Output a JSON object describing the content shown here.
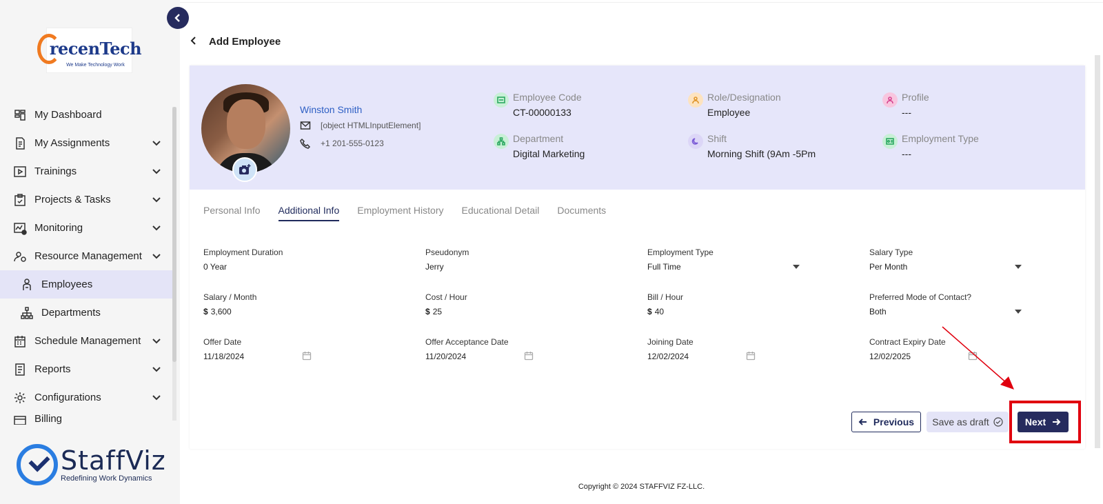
{
  "sidebar": {
    "brand_top": {
      "name_part1": "recen",
      "name_part2": "Tech",
      "tagline": "We Make Technology Work"
    },
    "items": [
      {
        "label": "My Dashboard",
        "icon": "dashboard-icon"
      },
      {
        "label": "My Assignments",
        "icon": "assignments-icon"
      },
      {
        "label": "Trainings",
        "icon": "play-icon"
      },
      {
        "label": "Projects & Tasks",
        "icon": "clipboard-icon"
      },
      {
        "label": "Monitoring",
        "icon": "monitoring-icon"
      },
      {
        "label": "Resource Management",
        "icon": "resource-icon"
      },
      {
        "label": "Employees",
        "icon": "employee-icon",
        "active": true
      },
      {
        "label": "Departments",
        "icon": "org-chart-icon"
      },
      {
        "label": "Schedule Management",
        "icon": "calendar-icon"
      },
      {
        "label": "Reports",
        "icon": "report-icon"
      },
      {
        "label": "Configurations",
        "icon": "settings-icon"
      },
      {
        "label": "Billing",
        "icon": "billing-icon"
      }
    ],
    "brand_bottom": {
      "name": "StaffViz",
      "tagline": "Redefining Work Dynamics"
    }
  },
  "page": {
    "title": "Add Employee"
  },
  "profile": {
    "name": "Winston Smith",
    "email": "[object HTMLInputElement]",
    "phone": "+1 201-555-0123",
    "meta": {
      "employee_code": {
        "label": "Employee Code",
        "value": "CT-00000133"
      },
      "role": {
        "label": "Role/Designation",
        "value": "Employee"
      },
      "profile": {
        "label": "Profile",
        "value": "---"
      },
      "department": {
        "label": "Department",
        "value": "Digital Marketing"
      },
      "shift": {
        "label": "Shift",
        "value": "Morning Shift (9Am -5Pm"
      },
      "employment_type": {
        "label": "Employment Type",
        "value": "---"
      }
    }
  },
  "tabs": [
    "Personal Info",
    "Additional Info",
    "Employment History",
    "Educational Detail",
    "Documents"
  ],
  "form": {
    "employment_duration": {
      "label": "Employment Duration",
      "value": "0 Year"
    },
    "pseudonym": {
      "label": "Pseudonym",
      "value": "Jerry"
    },
    "employment_type": {
      "label": "Employment Type",
      "value": "Full Time"
    },
    "salary_type": {
      "label": "Salary Type",
      "value": "Per Month"
    },
    "salary_month": {
      "label": "Salary / Month",
      "currency": "$",
      "value": "3,600"
    },
    "cost_hour": {
      "label": "Cost / Hour",
      "currency": "$",
      "value": "25"
    },
    "bill_hour": {
      "label": "Bill / Hour",
      "currency": "$",
      "value": "40"
    },
    "contact_mode": {
      "label": "Preferred Mode of Contact?",
      "value": "Both"
    },
    "offer_date": {
      "label": "Offer Date",
      "value": "11/18/2024"
    },
    "offer_acceptance_date": {
      "label": "Offer Acceptance Date",
      "value": "11/20/2024"
    },
    "joining_date": {
      "label": "Joining Date",
      "value": "12/02/2024"
    },
    "contract_expiry_date": {
      "label": "Contract Expiry Date",
      "value": "12/02/2025"
    }
  },
  "buttons": {
    "previous": "Previous",
    "save_draft": "Save as draft",
    "next": "Next"
  },
  "footer": {
    "copyright": "Copyright © 2024 STAFFVIZ FZ-LLC."
  },
  "colors": {
    "primary": "#262b5e",
    "profile_bg": "#e6e6fa",
    "link": "#2d5fc4",
    "highlight": "#e0000e"
  }
}
